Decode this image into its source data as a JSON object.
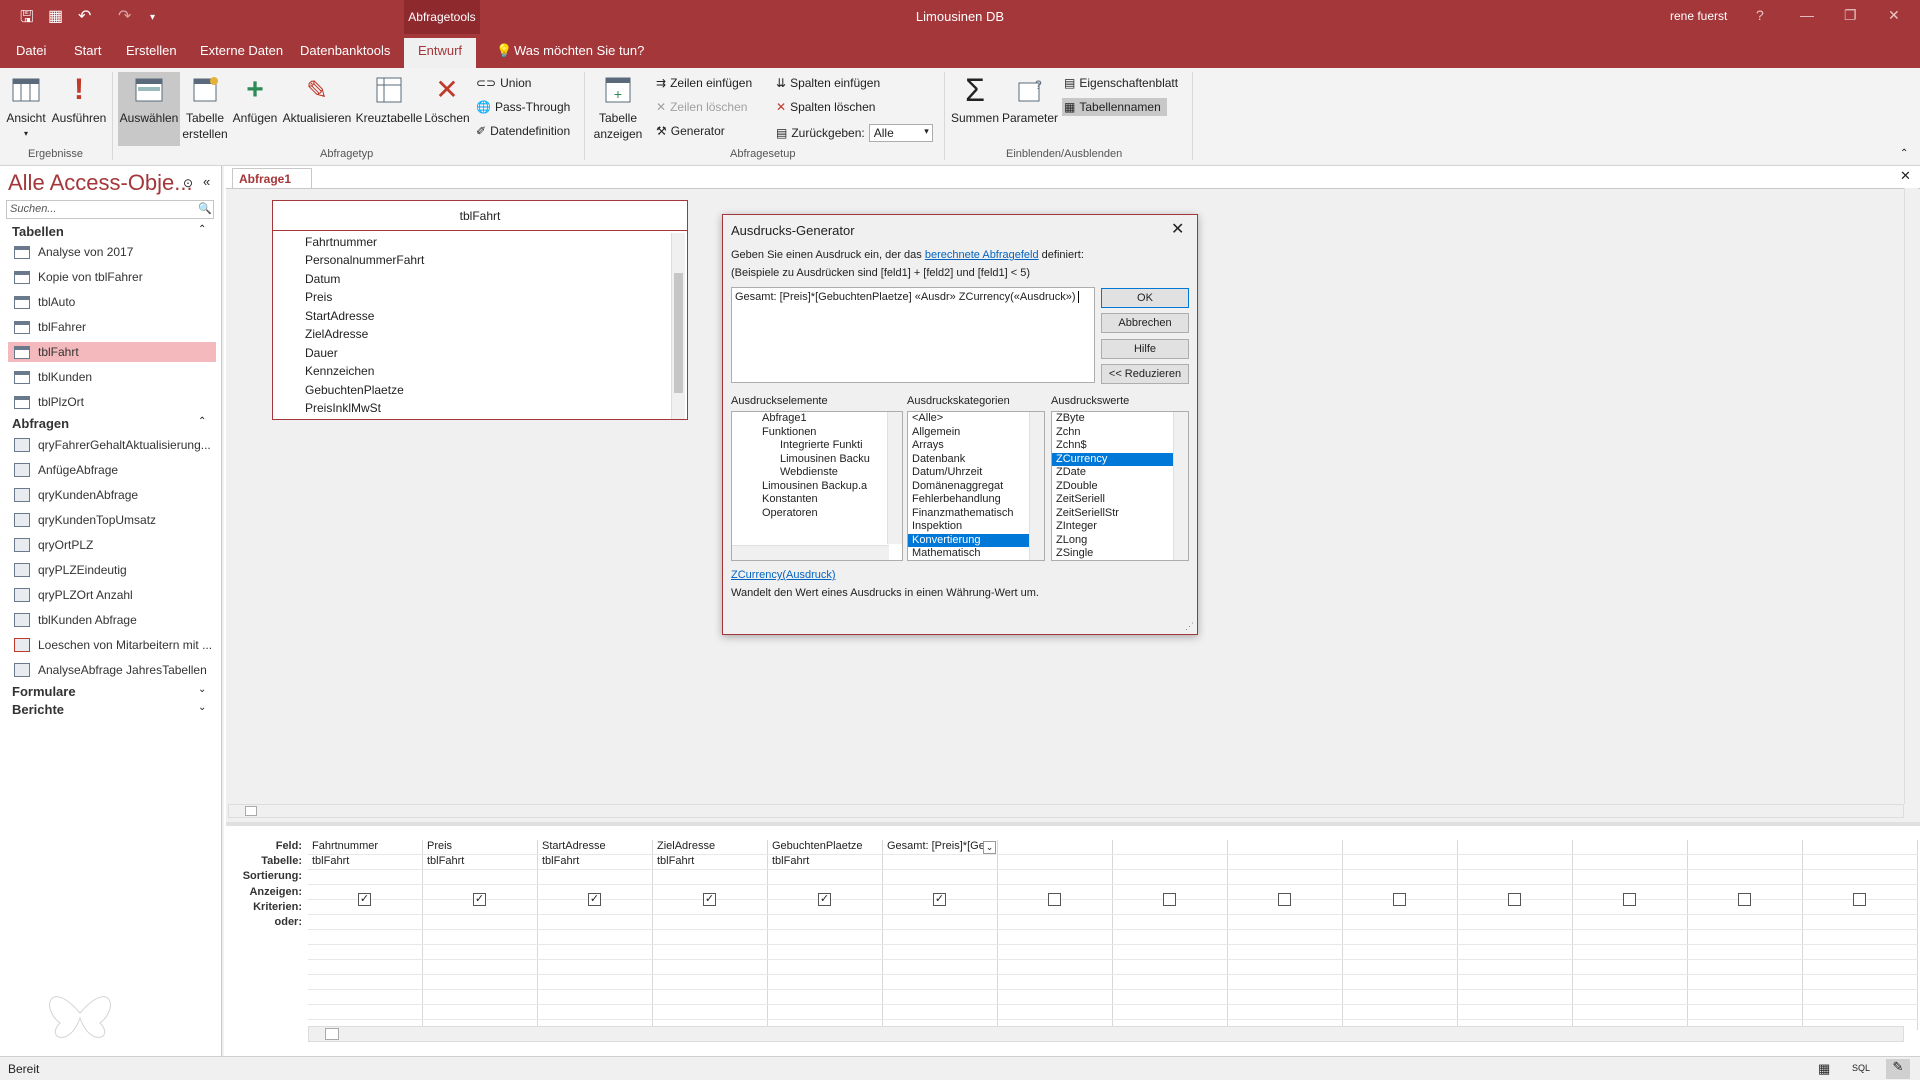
{
  "titlebar": {
    "context_tab": "Abfragetools",
    "app_title": "Limousinen DB",
    "user": "rene fuerst",
    "help": "?"
  },
  "menu_tabs": [
    "Datei",
    "Start",
    "Erstellen",
    "Externe Daten",
    "Datenbanktools",
    "Entwurf"
  ],
  "tell_me": "Was möchten Sie tun?",
  "ribbon": {
    "ergebnisse": {
      "label": "Ergebnisse",
      "ansicht": "Ansicht",
      "ausfuehren": "Ausführen"
    },
    "abfragetyp": {
      "label": "Abfragetyp",
      "auswaehlen": "Auswählen",
      "tabelle_erstellen": "Tabelle erstellen",
      "anfuegen": "Anfügen",
      "aktualisieren": "Aktualisieren",
      "kreuztabelle": "Kreuztabelle",
      "loeschen": "Löschen",
      "union": "Union",
      "pass_through": "Pass-Through",
      "datendefinition": "Datendefinition"
    },
    "abfragesetup": {
      "label": "Abfragesetup",
      "tabelle_anzeigen": "Tabelle anzeigen",
      "zeilen_einfuegen": "Zeilen einfügen",
      "zeilen_loeschen": "Zeilen löschen",
      "generator": "Generator",
      "spalten_einfuegen": "Spalten einfügen",
      "spalten_loeschen": "Spalten löschen",
      "zurueckgeben": "Zurückgeben:",
      "zurueckgeben_value": "Alle"
    },
    "einblenden": {
      "label": "Einblenden/Ausblenden",
      "summen": "Summen",
      "parameter": "Parameter",
      "eigenschaftenblatt": "Eigenschaftenblatt",
      "tabellennamen": "Tabellennamen"
    }
  },
  "nav": {
    "title": "Alle Access-Obje...",
    "search_placeholder": "Suchen...",
    "groups": {
      "tabellen": "Tabellen",
      "abfragen": "Abfragen",
      "formulare": "Formulare",
      "berichte": "Berichte"
    },
    "tables": [
      "Analyse von 2017",
      "Kopie von tblFahrer",
      "tblAuto",
      "tblFahrer",
      "tblFahrt",
      "tblKunden",
      "tblPlzOrt"
    ],
    "queries": [
      "qryFahrerGehaltAktualisierung...",
      "AnfügeAbfrage",
      "qryKundenAbfrage",
      "qryKundenTopUmsatz",
      "qryOrtPLZ",
      "qryPLZEindeutig",
      "qryPLZOrt Anzahl",
      "tblKunden Abfrage",
      "Loeschen von Mitarbeitern mit ...",
      "AnalyseAbfrage JahresTabellen"
    ]
  },
  "doc_tab": "Abfrage1",
  "table_box": {
    "title": "tblFahrt",
    "fields": [
      "Fahrtnummer",
      "PersonalnummerFahrt",
      "Datum",
      "Preis",
      "StartAdresse",
      "ZielAdresse",
      "Dauer",
      "Kennzeichen",
      "GebuchtenPlaetze",
      "PreisInklMwSt"
    ]
  },
  "dialog": {
    "title": "Ausdrucks-Generator",
    "intro_prefix": "Geben Sie einen Ausdruck ein, der das ",
    "intro_link": "berechnete Abfragefeld",
    "intro_suffix": " definiert:",
    "example": "(Beispiele zu Ausdrücken sind [feld1] + [feld2] und [feld1] < 5)",
    "expression": "Gesamt: [Preis]*[GebuchtenPlaetze] «Ausdr» ZCurrency(«Ausdruck»)",
    "buttons": {
      "ok": "OK",
      "abbrechen": "Abbrechen",
      "hilfe": "Hilfe",
      "reduzieren": "<< Reduzieren"
    },
    "elements_label": "Ausdruckselemente",
    "elements": [
      "Abfrage1",
      "Funktionen",
      "Integrierte Funkti",
      "Limousinen Backu",
      "Webdienste",
      "Limousinen Backup.a",
      "Konstanten",
      "Operatoren"
    ],
    "categories_label": "Ausdruckskategorien",
    "categories": [
      "<Alle>",
      "Allgemein",
      "Arrays",
      "Datenbank",
      "Datum/Uhrzeit",
      "Domänenaggregat",
      "Fehlerbehandlung",
      "Finanzmathematisch",
      "Inspektion",
      "Konvertierung",
      "Mathematisch"
    ],
    "categories_selected": "Konvertierung",
    "values_label": "Ausdruckswerte",
    "values": [
      "ZByte",
      "Zchn",
      "Zchn$",
      "ZCurrency",
      "ZDate",
      "ZDouble",
      "ZeitSeriell",
      "ZeitSeriellStr",
      "ZInteger",
      "ZLong",
      "ZSingle"
    ],
    "values_selected": "ZCurrency",
    "syntax": "ZCurrency(Ausdruck)",
    "description": "Wandelt den Wert eines Ausdrucks in einen Währung-Wert um."
  },
  "qbe": {
    "row_labels": [
      "Feld:",
      "Tabelle:",
      "Sortierung:",
      "Anzeigen:",
      "Kriterien:",
      "oder:"
    ],
    "columns": [
      {
        "feld": "Fahrtnummer",
        "tabelle": "tblFahrt",
        "anzeigen": true
      },
      {
        "feld": "Preis",
        "tabelle": "tblFahrt",
        "anzeigen": true
      },
      {
        "feld": "StartAdresse",
        "tabelle": "tblFahrt",
        "anzeigen": true
      },
      {
        "feld": "ZielAdresse",
        "tabelle": "tblFahrt",
        "anzeigen": true
      },
      {
        "feld": "GebuchtenPlaetze",
        "tabelle": "tblFahrt",
        "anzeigen": true
      },
      {
        "feld": "Gesamt: [Preis]*[Ge",
        "tabelle": "",
        "anzeigen": true
      },
      {
        "feld": "",
        "tabelle": "",
        "anzeigen": false
      },
      {
        "feld": "",
        "tabelle": "",
        "anzeigen": false
      },
      {
        "feld": "",
        "tabelle": "",
        "anzeigen": false
      },
      {
        "feld": "",
        "tabelle": "",
        "anzeigen": false
      },
      {
        "feld": "",
        "tabelle": "",
        "anzeigen": false
      },
      {
        "feld": "",
        "tabelle": "",
        "anzeigen": false
      },
      {
        "feld": "",
        "tabelle": "",
        "anzeigen": false
      },
      {
        "feld": "",
        "tabelle": "",
        "anzeigen": false
      }
    ]
  },
  "status": {
    "text": "Bereit",
    "sql_label": "SQL"
  }
}
